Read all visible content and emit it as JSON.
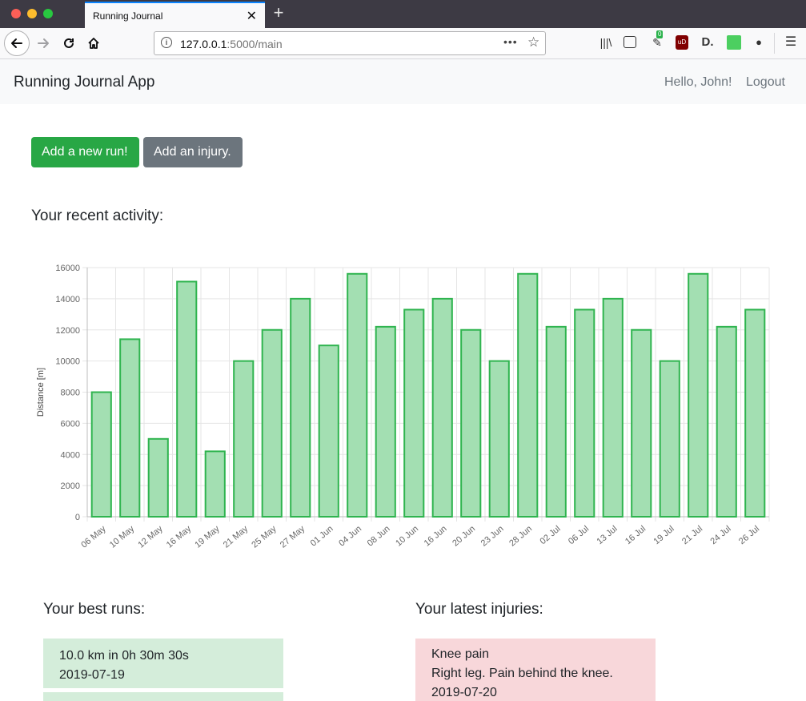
{
  "browser": {
    "tab_title": "Running Journal",
    "tab_close": "✕",
    "new_tab": "+",
    "url_host": "127.0.0.1",
    "url_rest": ":5000/main",
    "url_more": "•••",
    "ext_badge": "0",
    "ext_ublock": "uD",
    "ext_d": "D."
  },
  "app": {
    "brand": "Running Journal App",
    "greeting": "Hello, John!",
    "logout": "Logout"
  },
  "buttons": {
    "add_run": "Add a new run!",
    "add_injury": "Add an injury."
  },
  "activity_heading": "Your recent activity:",
  "colors": {
    "bar_fill": "#a3dfb2",
    "bar_stroke": "#2fb44f",
    "success": "#28a745",
    "secondary": "#6c757d",
    "run_card": "#d4edda",
    "injury_card": "#f8d7da"
  },
  "chart_data": {
    "type": "bar",
    "categories": [
      "06 May",
      "10 May",
      "12 May",
      "16 May",
      "19 May",
      "21 May",
      "25 May",
      "27 May",
      "01 Jun",
      "04 Jun",
      "08 Jun",
      "10 Jun",
      "16 Jun",
      "20 Jun",
      "23 Jun",
      "28 Jun",
      "02 Jul",
      "06 Jul",
      "13 Jul",
      "16 Jul",
      "19 Jul",
      "21 Jul",
      "24 Jul",
      "26 Jul"
    ],
    "values": [
      8000,
      11400,
      5000,
      15100,
      4200,
      10000,
      12000,
      14000,
      11000,
      15600,
      12200,
      13300,
      14000,
      12000,
      10000,
      15600,
      12200,
      13300,
      14000,
      12000,
      10000,
      15600,
      12200,
      13300
    ],
    "ylabel": "Distance [m]",
    "xlabel": "",
    "ylim": [
      0,
      16000
    ],
    "yticks": [
      0,
      2000,
      4000,
      6000,
      8000,
      10000,
      12000,
      14000,
      16000
    ],
    "grid": true
  },
  "best_runs": {
    "heading": "Your best runs:",
    "items": [
      {
        "line1": "10.0 km in 0h 30m 30s",
        "line2": "2019-07-19"
      }
    ]
  },
  "injuries": {
    "heading": "Your latest injuries:",
    "items": [
      {
        "title": "Knee pain",
        "desc": "Right leg. Pain behind the knee.",
        "date": "2019-07-20"
      }
    ]
  }
}
